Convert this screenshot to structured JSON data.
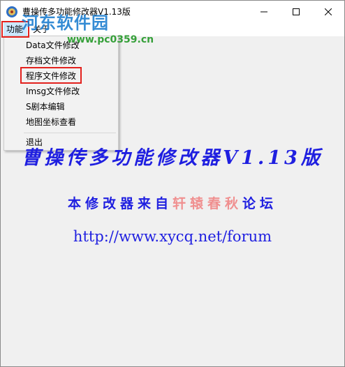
{
  "window": {
    "title": "曹操传多功能修改器V1.13版",
    "controls": {
      "minimize_icon": "minimize-icon",
      "maximize_icon": "maximize-icon",
      "close_icon": "close-icon"
    }
  },
  "watermark": {
    "main": "河东软件园",
    "url": "www.pc0359.cn"
  },
  "menubar": {
    "items": [
      {
        "label": "功能"
      },
      {
        "label": "关于"
      }
    ]
  },
  "dropdown": {
    "items": [
      {
        "label": "Data文件修改"
      },
      {
        "label": "存档文件修改"
      },
      {
        "label": "程序文件修改"
      },
      {
        "label": "Imsg文件修改"
      },
      {
        "label": "S剧本编辑"
      },
      {
        "label": "地图坐标查看"
      },
      {
        "label": "退出"
      }
    ]
  },
  "content": {
    "title": "曹操传多功能修改器V1.13版",
    "subtitle_part1": "本修改器来自",
    "subtitle_part2": "轩辕春秋",
    "subtitle_part3": "论坛",
    "url": "http://www.xycq.net/forum"
  },
  "colors": {
    "accent_blue": "#1f1fe0",
    "pink": "#f08f8f",
    "highlight_red": "#e3211d",
    "menu_hover": "#cce8ff"
  }
}
